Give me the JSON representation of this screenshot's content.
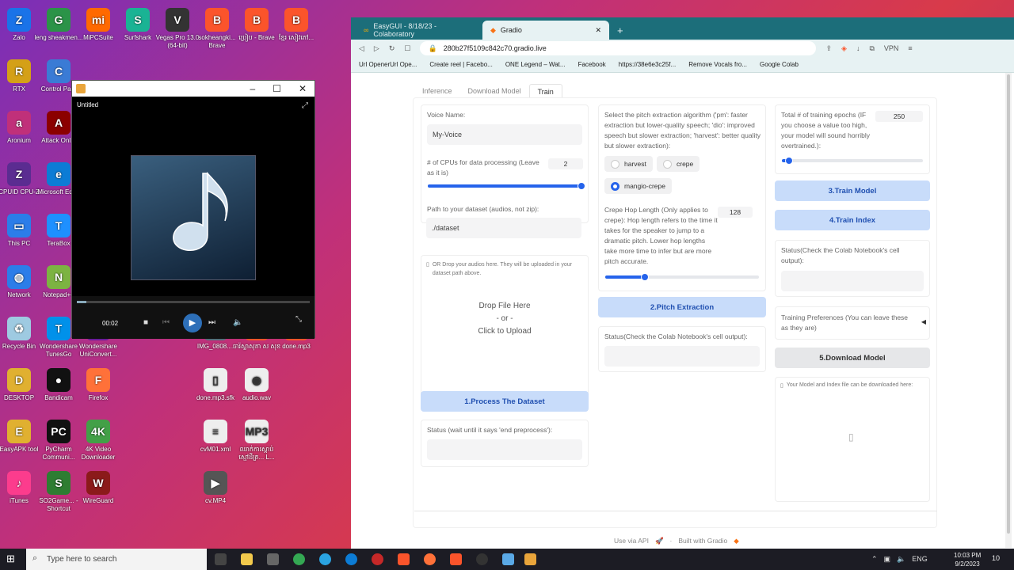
{
  "desktop": {
    "icons": [
      {
        "label": "Zalo",
        "color": "#1a73e8",
        "glyph": "Z"
      },
      {
        "label": "leng sheakmen...",
        "color": "#2b9348",
        "glyph": "G"
      },
      {
        "label": "MiPCSuite",
        "color": "#ff6900",
        "glyph": "mi"
      },
      {
        "label": "Surfshark",
        "color": "#1ab394",
        "glyph": "S"
      },
      {
        "label": "Vegas Pro 13.0 (64-bit)",
        "color": "#333333",
        "glyph": "V"
      },
      {
        "label": "sokheangki... Brave",
        "color": "#fb542b",
        "glyph": "B"
      },
      {
        "label": "ប្រៀប - Brave",
        "color": "#fb542b",
        "glyph": "B"
      },
      {
        "label": "ខ្មែរ សៀវភៅ...",
        "color": "#fb542b",
        "glyph": "B"
      },
      {
        "label": "RTX",
        "color": "#d4a017",
        "glyph": "R"
      },
      {
        "label": "Control Pa...",
        "color": "#3a7bd5",
        "glyph": "C"
      },
      {
        "label": "Aronium",
        "color": "#c0307a",
        "glyph": "a"
      },
      {
        "label": "Attack Onl...",
        "color": "#8b0000",
        "glyph": "A"
      },
      {
        "label": "CPUID CPU-Z",
        "color": "#5b2c91",
        "glyph": "Z"
      },
      {
        "label": "Microsoft Edge",
        "color": "#0c7cd5",
        "glyph": "e"
      },
      {
        "label": "This PC",
        "color": "#2b7de9",
        "glyph": "▭"
      },
      {
        "label": "TeraBox",
        "color": "#1e90ff",
        "glyph": "T"
      },
      {
        "label": "Network",
        "color": "#2b7de9",
        "glyph": "◍"
      },
      {
        "label": "Notepad++",
        "color": "#7cb342",
        "glyph": "N"
      },
      {
        "label": "Recycle Bin",
        "color": "#9ecae1",
        "glyph": "♻"
      },
      {
        "label": "Wondershare TunesGo",
        "color": "#0091ea",
        "glyph": "T"
      },
      {
        "label": "Wondershare UniConvert...",
        "color": "#6a1b9a",
        "glyph": "U"
      },
      {
        "label": "DESKTOP",
        "color": "#e0b030",
        "glyph": "D"
      },
      {
        "label": "Bandicam",
        "color": "#111111",
        "glyph": "●"
      },
      {
        "label": "Firefox",
        "color": "#ff7139",
        "glyph": "F"
      },
      {
        "label": "EasyAPK tool",
        "color": "#e0b030",
        "glyph": "E"
      },
      {
        "label": "PyCharm Communi...",
        "color": "#111111",
        "glyph": "PC"
      },
      {
        "label": "4K Video Downloader",
        "color": "#43a047",
        "glyph": "4K"
      },
      {
        "label": "iTunes",
        "color": "#fc3c8d",
        "glyph": "♪"
      },
      {
        "label": "SO2Game... - Shortcut",
        "color": "#2e7d32",
        "glyph": "S"
      },
      {
        "label": "WireGuard",
        "color": "#8b1a1a",
        "glyph": "W"
      },
      {
        "label": "IMG_0808....",
        "color": "#546e7a",
        "glyph": "▣"
      },
      {
        "label": "ចារ៉ស្លាសុភា ស សុខ",
        "color": "#fb542b",
        "glyph": "B"
      },
      {
        "label": "done.mp3",
        "color": "#fb542b",
        "glyph": "B"
      },
      {
        "label": "done.mp3.sfk",
        "color": "#eeeeee",
        "glyph": "▯"
      },
      {
        "label": "audio.wav",
        "color": "#eeeeee",
        "glyph": "◉"
      },
      {
        "label": "cvM01.xml",
        "color": "#eeeeee",
        "glyph": "≡"
      },
      {
        "label": "ឈាក់ការស្ដាប់ ស្មៅដីត្រ... L...",
        "color": "#eeeeee",
        "glyph": "MP3"
      },
      {
        "label": "cv.MP4",
        "color": "#555555",
        "glyph": "▶"
      }
    ]
  },
  "player": {
    "window_title": "Untitled",
    "elapsed": "00:02",
    "controls": {
      "minimize": "–",
      "maximize": "☐",
      "close": "✕"
    },
    "progress_fraction": 0.04
  },
  "browser": {
    "tabs": [
      {
        "label": "EasyGUI - 8/18/23 - Colaboratory"
      },
      {
        "label": "Gradio"
      }
    ],
    "new_tab": "+",
    "url": "280b27f5109c842c70.gradio.live",
    "vpn": "VPN",
    "bookmarks": [
      "Url OpenerUrl Ope...",
      "Create reel | Facebo...",
      "ONE Legend – Wat...",
      "Facebook",
      "https://38e6e3c25f...",
      "Remove Vocals fro...",
      "Google Colab"
    ]
  },
  "gradio": {
    "tabs": [
      "Inference",
      "Download Model",
      "Train"
    ],
    "selected_tab": "Train",
    "voice_name_label": "Voice Name:",
    "voice_name_value": "My-Voice",
    "cpu_label": "# of CPUs for data processing (Leave as it is)",
    "cpu_value": "2",
    "cpu_fraction": 1.0,
    "dataset_path_label": "Path to your dataset (audios, not zip):",
    "dataset_path_value": "./dataset",
    "drop_hint": "OR Drop your audios here. They will be uploaded in your dataset path above.",
    "drop_file": "Drop File Here",
    "drop_or": "- or -",
    "click_upload": "Click to Upload",
    "process_button": "1.Process The Dataset",
    "status_preprocess_label": "Status (wait until it says 'end preprocess'):",
    "pitch_label": "Select the pitch extraction algorithm ('pm': faster extraction but lower-quality speech; 'dio': improved speech but slower extraction; 'harvest': better quality but slower extraction):",
    "pitch_options": [
      "harvest",
      "crepe",
      "mangio-crepe"
    ],
    "pitch_selected": "mangio-crepe",
    "hop_label": "Crepe Hop Length (Only applies to crepe): Hop length refers to the time it takes for the speaker to jump to a dramatic pitch. Lower hop lengths take more time to infer but are more pitch accurate.",
    "hop_value": "128",
    "hop_fraction": 0.26,
    "pitch_button": "2.Pitch Extraction",
    "status_colab_label": "Status(Check the Colab Notebook's cell output):",
    "epochs_label": "Total # of training epochs (IF you choose a value too high, your model will sound horribly overtrained.):",
    "epochs_value": "250",
    "epochs_fraction": 0.05,
    "train_model_button": "3.Train Model",
    "train_index_button": "4.Train Index",
    "status_colab_label2": "Status(Check the Colab Notebook's cell output):",
    "training_prefs": "Training Preferences (You can leave these as they are)",
    "download_button": "5.Download Model",
    "download_hint": "Your Model and Index file can be downloaded here:",
    "footer_api": "Use via API",
    "footer_sep": "·",
    "footer_built": "Built with Gradio"
  },
  "taskbar": {
    "search_placeholder": "Type here to search",
    "lang": "ENG",
    "time": "10:03 PM",
    "date": "9/2/2023",
    "notifications": "10"
  }
}
